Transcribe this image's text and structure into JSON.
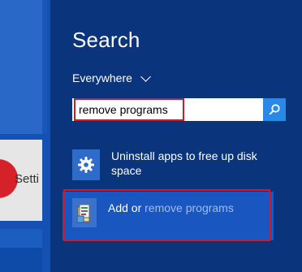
{
  "start": {
    "settings_tile_label": "Setti"
  },
  "search": {
    "title": "Search",
    "scope": "Everywhere",
    "query": "remove programs"
  },
  "results": [
    {
      "label": "Uninstall apps to free up disk space",
      "icon": "gear-icon"
    },
    {
      "label_prefix": "Add or",
      "label_match": "remove programs",
      "icon": "programs-icon"
    }
  ],
  "colors": {
    "pane_bg": "#0a347b",
    "highlight_red": "#d11a25",
    "search_button": "#2a88e6",
    "selected_result": "#1a56c0"
  }
}
